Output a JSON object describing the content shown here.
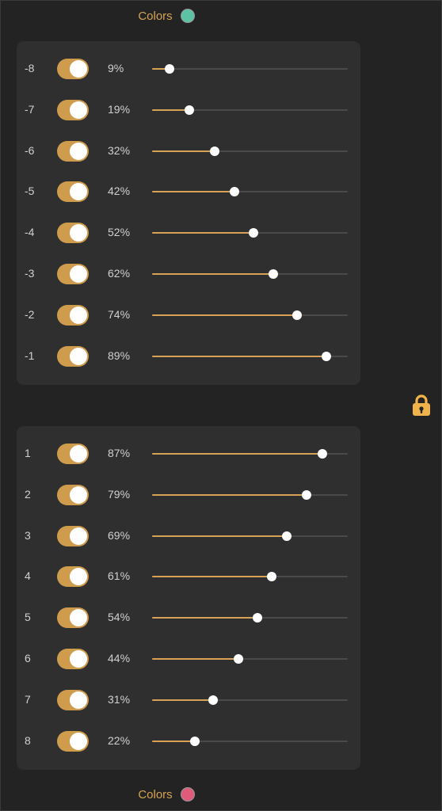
{
  "header_top": {
    "label": "Colors",
    "swatch_color": "#5cc2a3"
  },
  "header_bottom": {
    "label": "Colors",
    "swatch_color": "#de5b7a"
  },
  "accent_color": "#d7a255",
  "lock_icon": "lock-icon",
  "negative_rows": [
    {
      "label": "-8",
      "value": "9%",
      "level": 0.09,
      "enabled": true
    },
    {
      "label": "-7",
      "value": "19%",
      "level": 0.19,
      "enabled": true
    },
    {
      "label": "-6",
      "value": "32%",
      "level": 0.32,
      "enabled": true
    },
    {
      "label": "-5",
      "value": "42%",
      "level": 0.42,
      "enabled": true
    },
    {
      "label": "-4",
      "value": "52%",
      "level": 0.52,
      "enabled": true
    },
    {
      "label": "-3",
      "value": "62%",
      "level": 0.62,
      "enabled": true
    },
    {
      "label": "-2",
      "value": "74%",
      "level": 0.74,
      "enabled": true
    },
    {
      "label": "-1",
      "value": "89%",
      "level": 0.89,
      "enabled": true
    }
  ],
  "positive_rows": [
    {
      "label": "1",
      "value": "87%",
      "level": 0.87,
      "enabled": true
    },
    {
      "label": "2",
      "value": "79%",
      "level": 0.79,
      "enabled": true
    },
    {
      "label": "3",
      "value": "69%",
      "level": 0.69,
      "enabled": true
    },
    {
      "label": "4",
      "value": "61%",
      "level": 0.61,
      "enabled": true
    },
    {
      "label": "5",
      "value": "54%",
      "level": 0.54,
      "enabled": true
    },
    {
      "label": "6",
      "value": "44%",
      "level": 0.44,
      "enabled": true
    },
    {
      "label": "7",
      "value": "31%",
      "level": 0.31,
      "enabled": true
    },
    {
      "label": "8",
      "value": "22%",
      "level": 0.22,
      "enabled": true
    }
  ]
}
